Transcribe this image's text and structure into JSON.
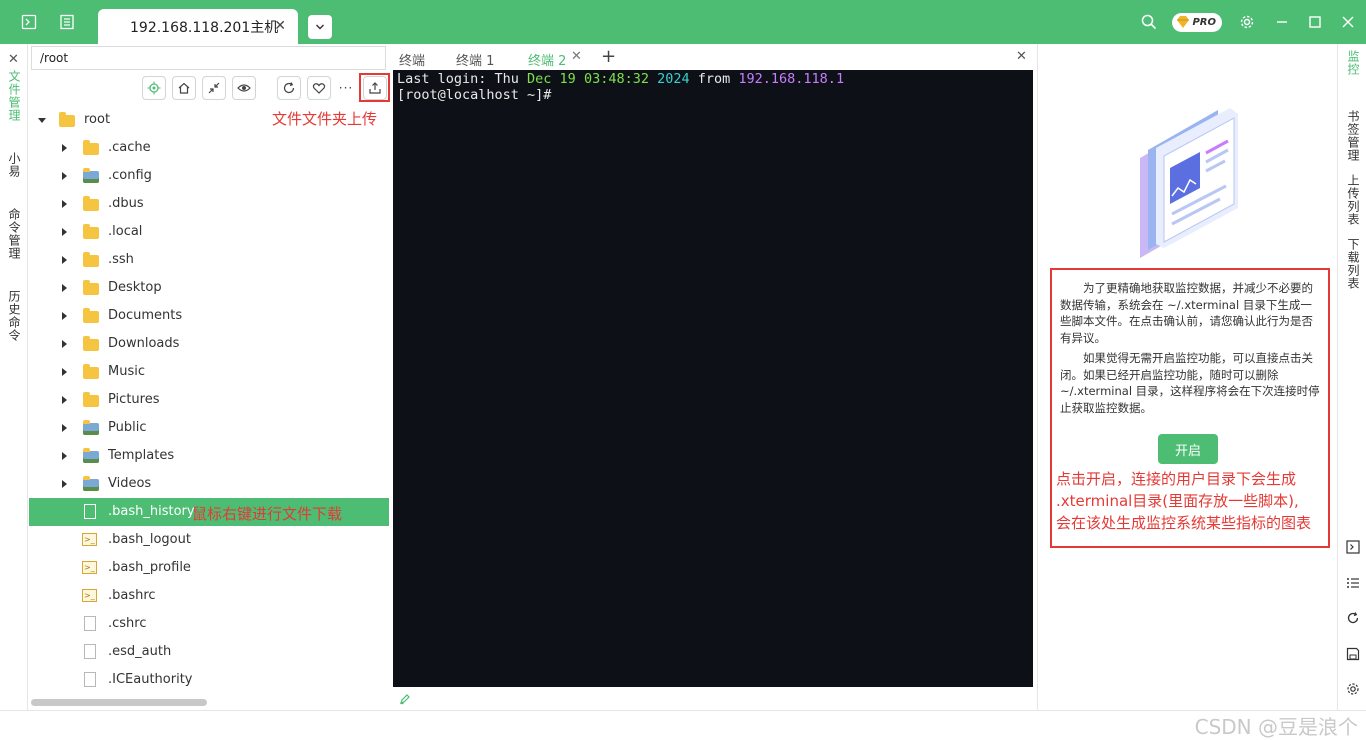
{
  "titlebar": {
    "tab_title": "192.168.118.201主机",
    "pro_label": "PRO",
    "accent": "#4dbd74",
    "icons": [
      "terminal-icon",
      "list-icon",
      "search-icon",
      "gear-icon",
      "minimize-icon",
      "maximize-icon",
      "close-icon"
    ]
  },
  "left_strip": {
    "tabs": [
      "文件管理",
      "小易",
      "命令管理",
      "历史命令"
    ]
  },
  "file_panel": {
    "path": "/root",
    "toolbar_icons": [
      "locate-icon",
      "home-icon",
      "collapse-icon",
      "eye-icon",
      "refresh-icon",
      "heart-icon",
      "more-icon",
      "upload-icon"
    ],
    "upload_annotation": "文件文件夹上传",
    "download_annotation": "鼠标右键进行文件下载",
    "tree": [
      {
        "label": "root",
        "type": "folder",
        "expanded": true
      },
      {
        "label": ".cache",
        "type": "folder"
      },
      {
        "label": ".config",
        "type": "folder-special"
      },
      {
        "label": ".dbus",
        "type": "folder"
      },
      {
        "label": ".local",
        "type": "folder"
      },
      {
        "label": ".ssh",
        "type": "folder"
      },
      {
        "label": "Desktop",
        "type": "folder"
      },
      {
        "label": "Documents",
        "type": "folder"
      },
      {
        "label": "Downloads",
        "type": "folder"
      },
      {
        "label": "Music",
        "type": "folder"
      },
      {
        "label": "Pictures",
        "type": "folder"
      },
      {
        "label": "Public",
        "type": "folder-special"
      },
      {
        "label": "Templates",
        "type": "folder-special"
      },
      {
        "label": "Videos",
        "type": "folder-special"
      },
      {
        "label": ".bash_history",
        "type": "file",
        "selected": true
      },
      {
        "label": ".bash_logout",
        "type": "script"
      },
      {
        "label": ".bash_profile",
        "type": "script"
      },
      {
        "label": ".bashrc",
        "type": "script"
      },
      {
        "label": ".cshrc",
        "type": "file"
      },
      {
        "label": ".esd_auth",
        "type": "file"
      },
      {
        "label": ".ICEauthority",
        "type": "file"
      }
    ]
  },
  "terminal": {
    "tabs": [
      {
        "label": "终端",
        "active": false
      },
      {
        "label": "终端 1",
        "active": false
      },
      {
        "label": "终端 2",
        "active": true
      }
    ],
    "line1": {
      "prefix": "Last login: Thu ",
      "date": "Dec 19 03:48:32",
      "year": "2024",
      "from": " from ",
      "ip": "192.168.118.1"
    },
    "prompt": "[root@localhost ~]#"
  },
  "monitor": {
    "paragraph1": "为了更精确地获取监控数据，并减少不必要的数据传输，系统会在 ~/.xterminal 目录下生成一些脚本文件。在点击确认前，请您确认此行为是否有异议。",
    "paragraph2": "如果觉得无需开启监控功能，可以直接点击关闭。如果已经开启监控功能，随时可以删除 ~/.xterminal 目录，这样程序将会在下次连接时停止获取监控数据。",
    "open_button": "开启",
    "annotation_lines": [
      "点击开启，连接的用户目录下会生成",
      ".xterminal目录(里面存放一些脚本),",
      "会在该处生成监控系统某些指标的图表"
    ]
  },
  "right_strip": {
    "tabs": [
      "监控",
      "书签管理",
      "上传列表",
      "下载列表"
    ],
    "icons": [
      "terminal-icon",
      "list-icon",
      "refresh-icon",
      "save-icon",
      "gear-icon"
    ]
  },
  "watermark": "CSDN @豆是浪个"
}
